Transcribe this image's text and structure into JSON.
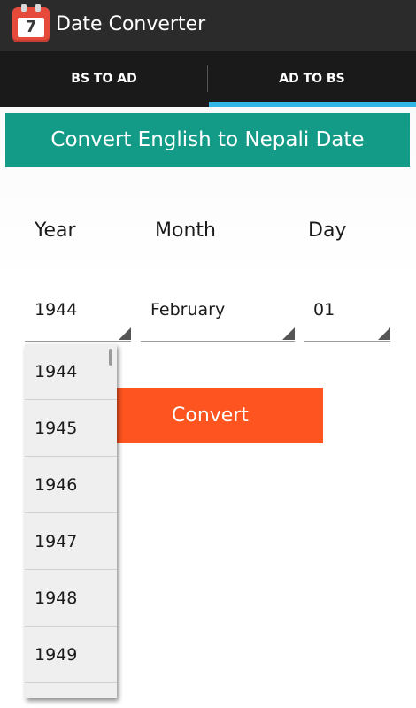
{
  "app": {
    "title": "Date Converter",
    "icon_number": "7",
    "icon": "calendar-icon"
  },
  "tabs": [
    {
      "label": "BS TO AD",
      "selected": false
    },
    {
      "label": "AD TO BS",
      "selected": true
    }
  ],
  "header": {
    "title": "Convert English to Nepali Date"
  },
  "labels": {
    "year": "Year",
    "month": "Month",
    "day": "Day"
  },
  "spinners": {
    "year": "1944",
    "month": "February",
    "day": "01"
  },
  "convert_button": {
    "label": "Convert"
  },
  "year_dropdown": {
    "items": [
      "1944",
      "1945",
      "1946",
      "1947",
      "1948",
      "1949"
    ]
  },
  "colors": {
    "header_bg": "#139b87",
    "button_bg": "#fd5420",
    "tab_indicator": "#33b5e5",
    "app_icon": "#e64a3b"
  }
}
